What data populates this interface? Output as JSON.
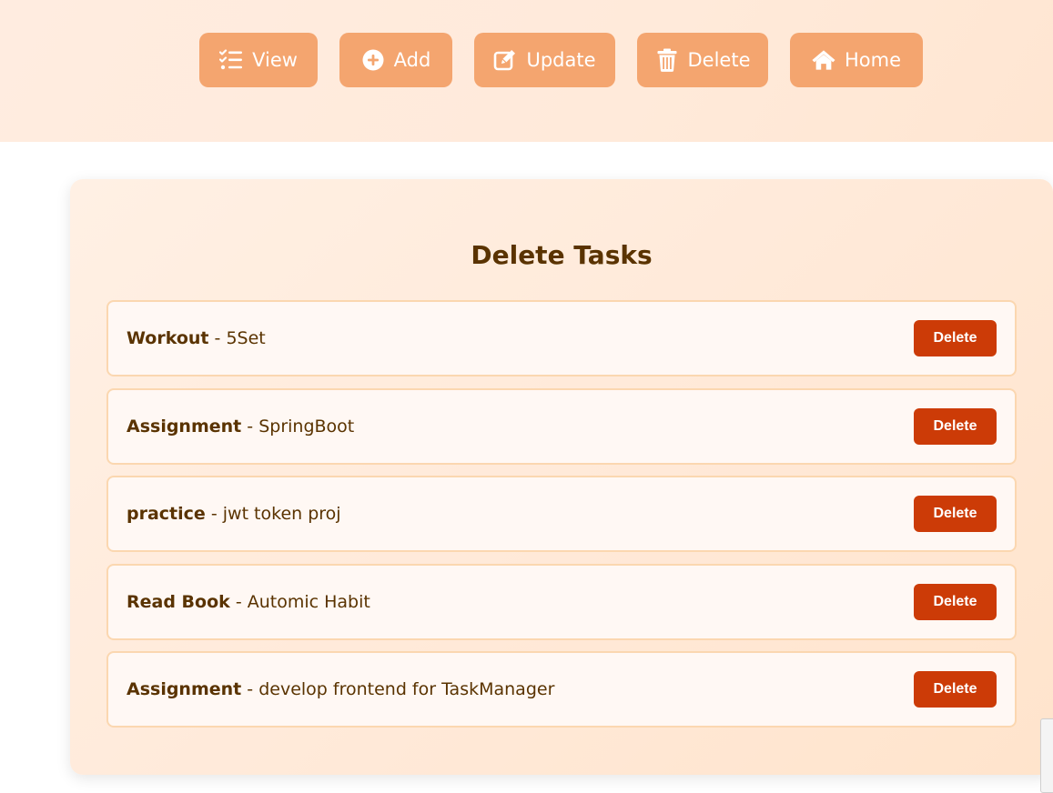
{
  "nav": {
    "buttons": [
      {
        "label": "View",
        "icon": "list-check-icon"
      },
      {
        "label": "Add",
        "icon": "plus-circle-icon"
      },
      {
        "label": "Update",
        "icon": "edit-icon"
      },
      {
        "label": "Delete",
        "icon": "trash-icon"
      },
      {
        "label": "Home",
        "icon": "home-icon"
      }
    ]
  },
  "main": {
    "title": "Delete Tasks",
    "separator": " - ",
    "delete_label": "Delete",
    "tasks": [
      {
        "title": "Workout",
        "description": "5Set"
      },
      {
        "title": "Assignment",
        "description": "SpringBoot"
      },
      {
        "title": "practice",
        "description": "jwt token proj"
      },
      {
        "title": "Read Book",
        "description": "Automic Habit"
      },
      {
        "title": "Assignment",
        "description": "develop frontend for TaskManager"
      }
    ]
  },
  "colors": {
    "nav_button": "#f4a56f",
    "delete_button": "#cc3b07",
    "text": "#5a3300"
  }
}
